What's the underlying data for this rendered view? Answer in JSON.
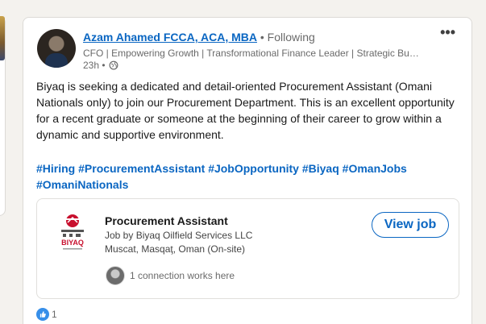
{
  "post": {
    "author": {
      "name": "Azam Ahamed FCCA, ACA, MBA",
      "follow_status": "• Following",
      "headline": "CFO | Empowering Growth | Transformational Finance Leader | Strategic Business Partner",
      "time": "23h •"
    },
    "more_label": "•••",
    "body": "Biyaq is seeking a dedicated and detail-oriented Procurement Assistant (Omani Nationals only) to join our Procurement Department. This is an excellent opportunity for a recent graduate or someone at the beginning of their career to grow within a dynamic and supportive environment.",
    "hashtags": [
      "#Hiring",
      "#ProcurementAssistant",
      "#JobOpportunity",
      "#Biyaq",
      "#OmanJobs",
      "#OmaniNationals"
    ],
    "job": {
      "title": "Procurement Assistant",
      "company": "Job by Biyaq Oilfield Services LLC",
      "location": "Muscat, Masqaţ, Oman (On-site)",
      "button_label": "View job",
      "connections": "1 connection works here",
      "logo_text": "BIYAQ"
    },
    "reactions_count": "1"
  },
  "colors": {
    "link": "#0a66c2",
    "like": "#378fe9",
    "logo_red": "#c8102e"
  },
  "icons": [
    "globe-icon",
    "more-options-icon",
    "biyaq-logo",
    "like-icon"
  ]
}
